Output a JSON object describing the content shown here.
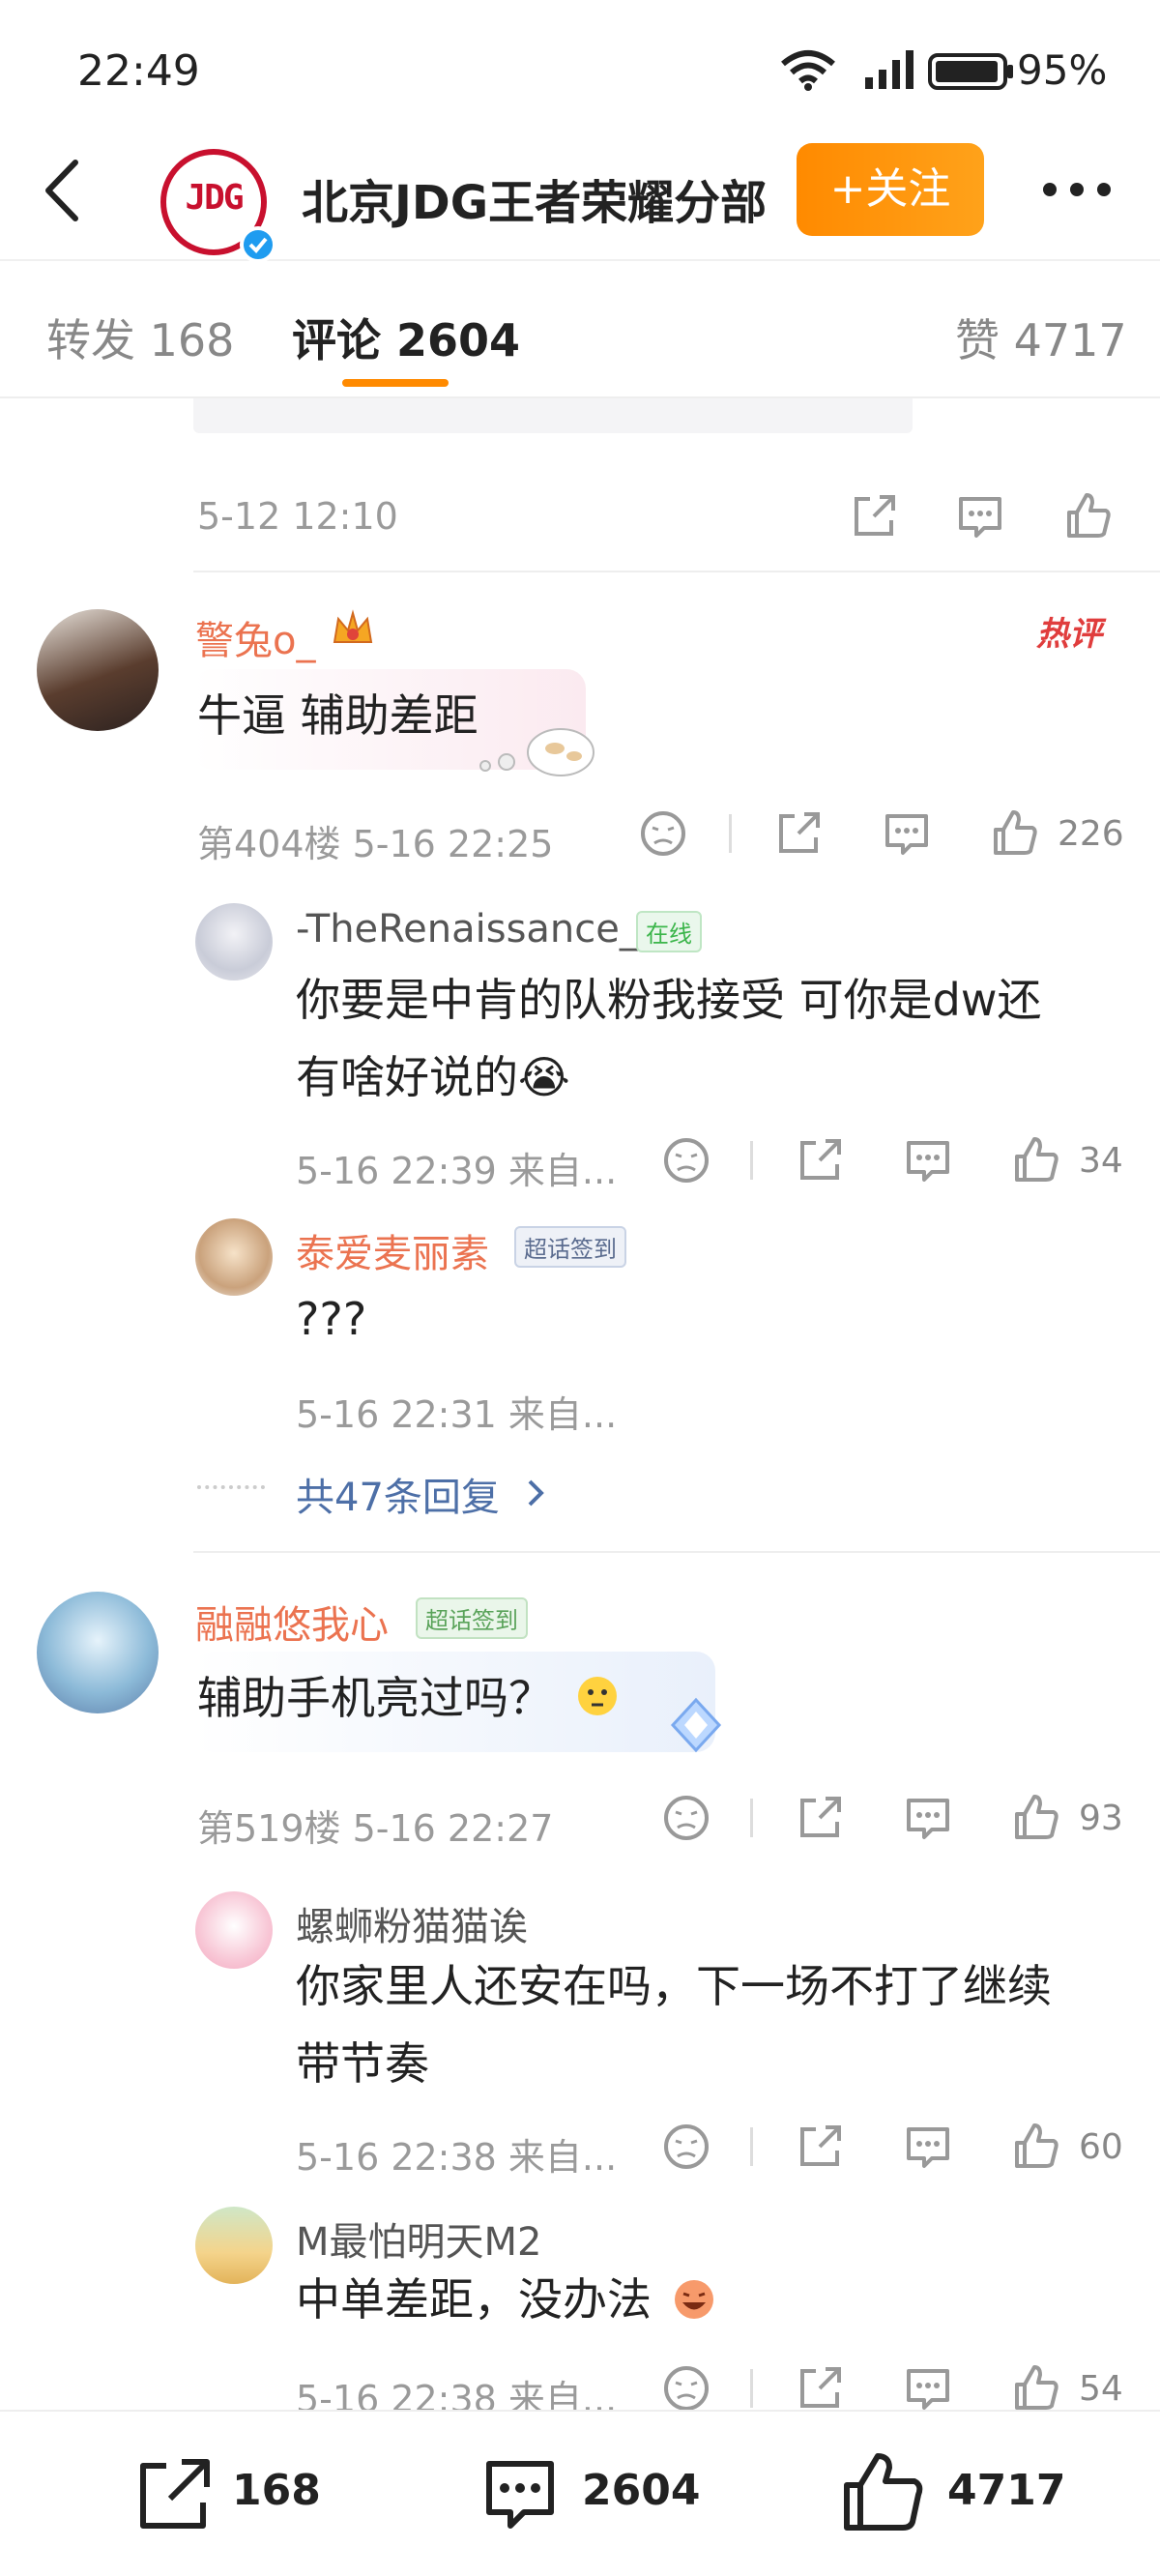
{
  "status": {
    "time": "22:49",
    "battery": "95%"
  },
  "header": {
    "account_name": "北京JDG王者荣耀分部",
    "logo_text": "JDG",
    "follow_label": "+关注"
  },
  "tabs": {
    "repost": "转发 168",
    "comment": "评论 2604",
    "like": "赞 4717"
  },
  "prev_post": {
    "time": "5-12 12:10"
  },
  "comments": [
    {
      "username": "警兔o_",
      "hot_label": "热评",
      "text": "牛逼 辅助差距",
      "meta": "第404楼 5-16 22:25",
      "likes": "226",
      "replies": [
        {
          "username": "-TheRenaissance_",
          "badge": "在线",
          "text1": "你要是中肯的队粉我接受 可你是dw还",
          "text2": "有啥好说的😭",
          "meta": "5-16 22:39 来自...",
          "likes": "34"
        },
        {
          "username": "泰爱麦丽素",
          "badge": "超话签到",
          "text1": "???",
          "meta": "5-16 22:31 来自..."
        }
      ],
      "more_replies": "共47条回复"
    },
    {
      "username": "融融悠我心",
      "badge": "超话签到",
      "text": "辅助手机亮过吗？",
      "meta": "第519楼 5-16 22:27",
      "likes": "93",
      "replies": [
        {
          "username": "螺蛳粉猫猫诶",
          "text1": "你家里人还安在吗，下一场不打了继续",
          "text2": "带节奏",
          "meta": "5-16 22:38 来自...",
          "likes": "60"
        },
        {
          "username": "M最怕明天M2",
          "text1": "中单差距，没办法",
          "meta": "5-16 22:38 来自...",
          "likes": "54"
        }
      ]
    }
  ],
  "bottom_bar": {
    "repost": "168",
    "comment": "2604",
    "like": "4717"
  },
  "colors": {
    "accent": "#ff8a00",
    "username": "#eb7350",
    "link": "#4d6fa7",
    "hot": "#e03d3d"
  }
}
